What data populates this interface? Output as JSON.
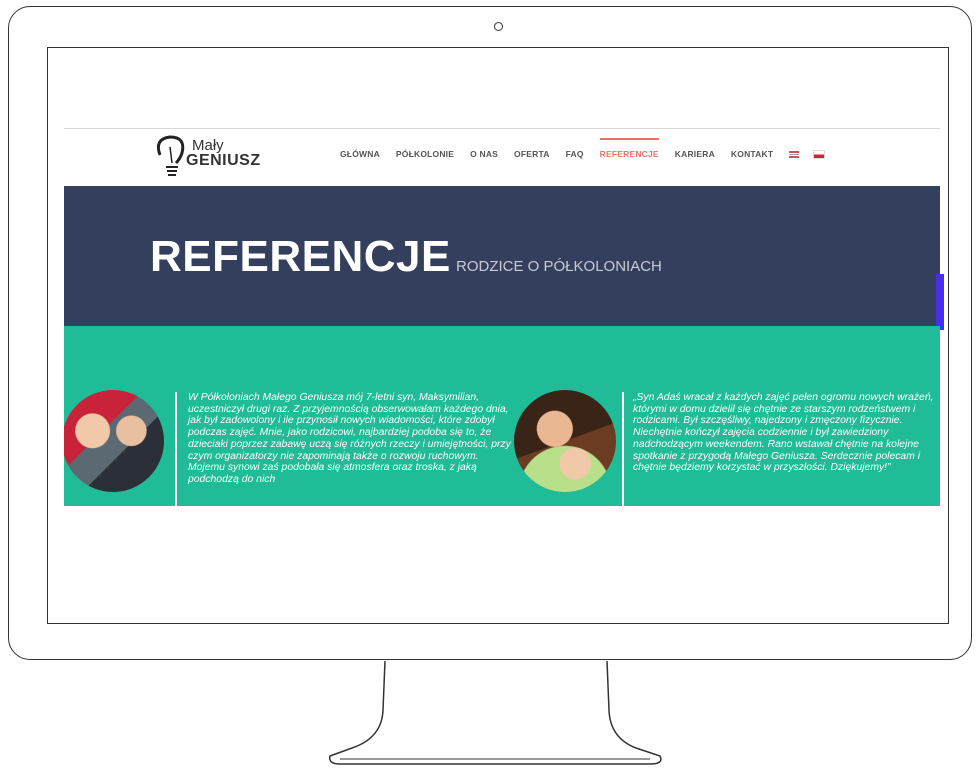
{
  "logo": {
    "line1": "Mały",
    "line2": "GENIUSZ"
  },
  "nav": {
    "items": [
      {
        "label": "GŁÓWNA",
        "active": false
      },
      {
        "label": "PÓŁKOLONIE",
        "active": false
      },
      {
        "label": "O NAS",
        "active": false
      },
      {
        "label": "OFERTA",
        "active": false
      },
      {
        "label": "FAQ",
        "active": false
      },
      {
        "label": "REFERENCJE",
        "active": true
      },
      {
        "label": "KARIERA",
        "active": false
      },
      {
        "label": "KONTAKT",
        "active": false
      }
    ],
    "flags": [
      "flag-en-icon",
      "flag-pl-icon"
    ]
  },
  "hero": {
    "title": "REFERENCJE",
    "subtitle": "RODZICE O PÓŁKOLONIACH"
  },
  "testimonials": [
    {
      "text": "W Półkoloniach Małego Geniusza mój 7-letni syn, Maksymilian, uczestniczył drugi raz. Z przyjemnością obserwowałam każdego dnia, jak był zadowolony i ile przynosił nowych wiadomości, które zdobył podczas zajęć. Mnie, jako rodzicowi, najbardziej podoba się to, że dzieciaki poprzez zabawę uczą się różnych rzeczy i umiejętności, przy czym organizatorzy nie zapominają także o rozwoju ruchowym. Mojemu synowi zaś podobała się atmosfera oraz troska, z jaką podchodzą do nich"
    },
    {
      "text": "„Syn Adaś wracał z każdych zajęć pełen ogromu nowych wrażeń, którymi w domu dzielił się chętnie ze starszym rodzeństwem i rodzicami. Był szczęśliwy, najedzony i zmęczony fizycznie. Niechętnie kończył zajęcia codziennie i był zawiedziony nadchodzącym weekendem. Rano wstawał chętnie na kolejne spotkanie z przygodą Małego Geniusza. Serdecznie polecam i chętnie będziemy korzystać w przyszłości. Dziękujemy!”"
    }
  ],
  "colors": {
    "hero_bg": "#333f5c",
    "green_bg": "#1fbc97",
    "accent": "#e8736e",
    "side_tab": "#4b2df2"
  }
}
